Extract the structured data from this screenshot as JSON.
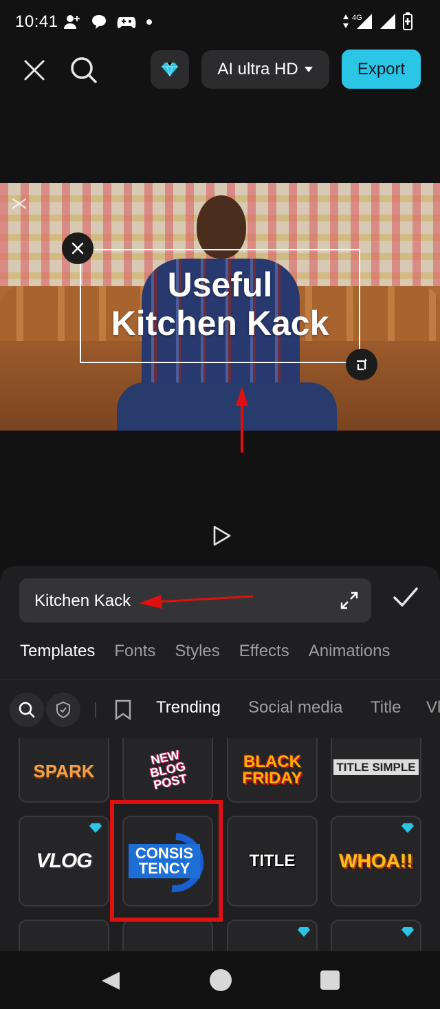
{
  "status_bar": {
    "time": "10:41",
    "network": "4G",
    "icons": [
      "person-add-icon",
      "chat-bubble-icon",
      "game-controller-icon",
      "dot-icon",
      "data-arrows-icon",
      "signal-icon",
      "signal-icon",
      "battery-icon"
    ]
  },
  "top_bar": {
    "resolution_label": "AI ultra HD",
    "export_label": "Export"
  },
  "preview": {
    "overlay_line1": "Useful",
    "overlay_line2": "Kitchen Kack"
  },
  "editor": {
    "text_value": "Kitchen Kack",
    "tabs": [
      "Templates",
      "Fonts",
      "Styles",
      "Effects",
      "Animations"
    ],
    "active_tab": "Templates",
    "filter_chips": [
      "Trending",
      "Social media",
      "Title",
      "Vl"
    ],
    "active_chip": "Trending"
  },
  "templates": [
    {
      "label": "SPARK",
      "premium": false
    },
    {
      "label": "NEW BLOG POST",
      "premium": false
    },
    {
      "label": "BLACK FRIDAY",
      "premium": false
    },
    {
      "label": "TITLE SIMPLE",
      "premium": false
    },
    {
      "label": "VLOG",
      "premium": true
    },
    {
      "label": "CONSIS TENCY",
      "premium": false
    },
    {
      "label": "TITLE",
      "premium": false
    },
    {
      "label": "WHOA!!",
      "premium": true
    }
  ],
  "colors": {
    "accent": "#2bc6e6",
    "highlight": "#e01010",
    "panel": "#1f1f21"
  }
}
